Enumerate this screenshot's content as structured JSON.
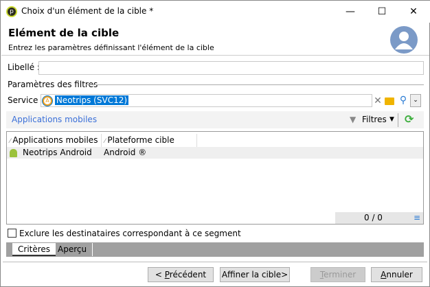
{
  "window": {
    "title": "Choix d'un élément de la cible *",
    "minimize": "—",
    "maximize": "☐",
    "close": "✕"
  },
  "header": {
    "title": "Elément de la cible",
    "subtitle": "Entrez les paramètres définissant l'élément de la cible"
  },
  "form": {
    "label_label": "Libellé :",
    "label_value": "",
    "filters_section": "Paramètres des filtres",
    "service_label": "Service :",
    "service_value": "Neotrips (SVC12)"
  },
  "toolbar": {
    "title": "Applications mobiles",
    "filters_label": "Filtres"
  },
  "list": {
    "columns": [
      "Applications mobiles",
      "Plateforme cible"
    ],
    "rows": [
      {
        "app": "Neotrips Android",
        "platform": "Android ®"
      }
    ],
    "count": "0 / 0"
  },
  "exclude_label": "Exclure les destinataires correspondant à ce segment",
  "tabs": [
    "Critères",
    "Aperçu"
  ],
  "buttons": {
    "prev_pre": "< ",
    "prev_u": "P",
    "prev_rest": "récédent",
    "refine": "Affiner la cible>",
    "finish_u": "T",
    "finish_rest": "erminer",
    "cancel_u": "A",
    "cancel_rest": "nnuler"
  },
  "colors": {
    "accent": "#0078d7",
    "link": "#3a6fd8",
    "refresh": "#3cae3c",
    "folder": "#f0b400"
  }
}
